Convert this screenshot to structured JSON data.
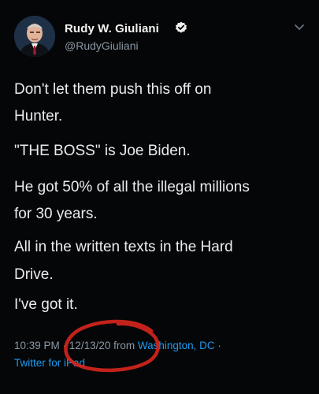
{
  "user": {
    "display_name": "Rudy W. Giuliani",
    "handle": "@RudyGiuliani",
    "verified_icon": "verified-badge-icon"
  },
  "tweet": {
    "lines": [
      "Don't let them push this off on",
      "Hunter.",
      "\"THE BOSS\" is Joe Biden.",
      "He got 50% of all the illegal millions",
      "for 30 years.",
      "All in the written texts in the Hard",
      "Drive.",
      "I've got it."
    ]
  },
  "meta": {
    "time": "10:39 PM",
    "sep1": " · ",
    "date": "12/13/20",
    "from": " from ",
    "location": "Washington, DC",
    "sep2": " ·",
    "client": "Twitter for iPad"
  },
  "colors": {
    "background": "#050607",
    "link": "#1d9bf0",
    "muted": "#8b98a5",
    "annotation": "#d8261e"
  }
}
